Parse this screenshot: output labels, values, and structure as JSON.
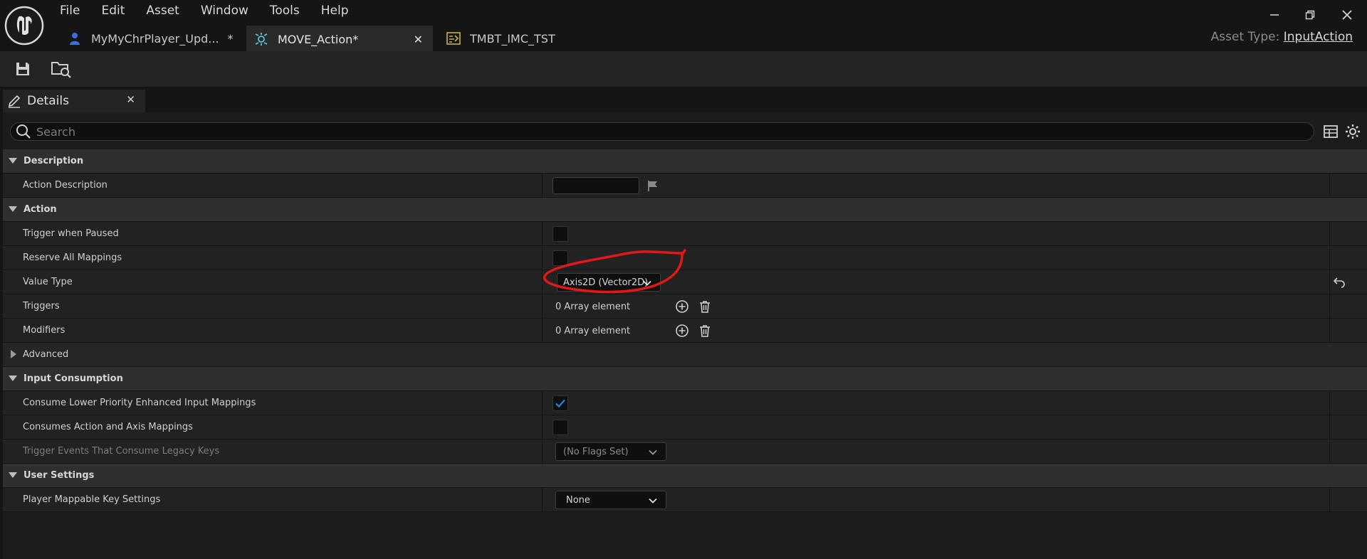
{
  "menu": [
    "File",
    "Edit",
    "Asset",
    "Window",
    "Tools",
    "Help"
  ],
  "tabs": [
    {
      "label": "MyMyChrPlayer_Upd...",
      "modified": "*"
    },
    {
      "label": "MOVE_Action*",
      "close": "✕"
    },
    {
      "label": "TMBT_IMC_TST"
    }
  ],
  "asset_type": {
    "label": "Asset Type:",
    "value": "InputAction"
  },
  "details_tab": {
    "label": "Details",
    "close": "✕"
  },
  "search": {
    "placeholder": "Search"
  },
  "rows": {
    "description": "Description",
    "action_description": "Action Description",
    "action": "Action",
    "trigger_when_paused": "Trigger when Paused",
    "reserve_all_mappings": "Reserve All Mappings",
    "value_type": "Value Type",
    "value_type_value": "Axis2D (Vector2D)",
    "triggers": "Triggers",
    "triggers_value": "0 Array element",
    "modifiers": "Modifiers",
    "modifiers_value": "0 Array element",
    "advanced": "Advanced",
    "input_consumption": "Input Consumption",
    "consume_lower": "Consume Lower Priority Enhanced Input Mappings",
    "consumes_action_axis": "Consumes Action and Axis Mappings",
    "trigger_events_legacy": "Trigger Events That Consume Legacy Keys",
    "trigger_events_value": "(No Flags Set)",
    "user_settings": "User Settings",
    "player_mappable": "Player Mappable Key Settings",
    "player_mappable_value": "None"
  },
  "state": {
    "consume_lower_checked": true
  },
  "colors": {
    "accent_check": "#2f7fe0",
    "annotation": "#e01818"
  }
}
